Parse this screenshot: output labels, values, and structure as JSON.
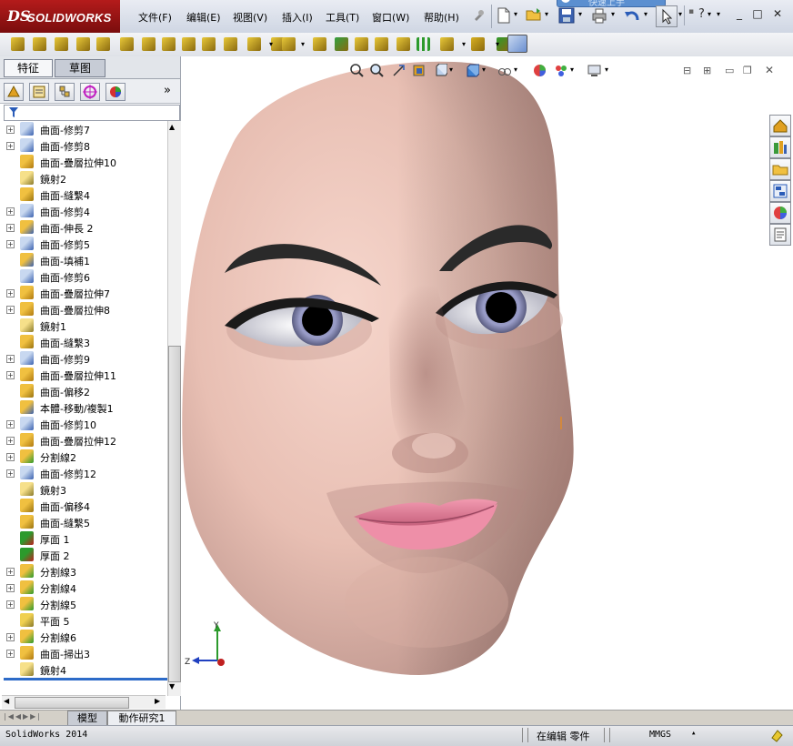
{
  "app": {
    "logo_ds": "DS",
    "logo_name": "SOLIDWORKS",
    "hint_text": "快速上手"
  },
  "menu": [
    {
      "label": "文件(F)"
    },
    {
      "label": "编辑(E)"
    },
    {
      "label": "视图(V)"
    },
    {
      "label": "插入(I)"
    },
    {
      "label": "工具(T)"
    },
    {
      "label": "窗口(W)"
    },
    {
      "label": "帮助(H)"
    }
  ],
  "panel_tabs": [
    {
      "label": "特征"
    },
    {
      "label": "草图"
    }
  ],
  "feature_tree": [
    {
      "label": "曲面-修剪7",
      "icon": "trim-icon",
      "expandable": true
    },
    {
      "label": "曲面-修剪8",
      "icon": "trim-icon",
      "expandable": true
    },
    {
      "label": "曲面-疊層拉伸10",
      "icon": "loft-icon",
      "expandable": false
    },
    {
      "label": "鏡射2",
      "icon": "mirror-icon",
      "expandable": false
    },
    {
      "label": "曲面-縫繫4",
      "icon": "knit-icon",
      "expandable": false
    },
    {
      "label": "曲面-修剪4",
      "icon": "trim-icon",
      "expandable": true
    },
    {
      "label": "曲面-伸長 2",
      "icon": "extend-icon",
      "expandable": true
    },
    {
      "label": "曲面-修剪5",
      "icon": "trim-icon",
      "expandable": true
    },
    {
      "label": "曲面-填補1",
      "icon": "fill-icon",
      "expandable": false
    },
    {
      "label": "曲面-修剪6",
      "icon": "trim-icon",
      "expandable": false
    },
    {
      "label": "曲面-疊層拉伸7",
      "icon": "loft-icon",
      "expandable": true
    },
    {
      "label": "曲面-疊層拉伸8",
      "icon": "loft-icon",
      "expandable": true
    },
    {
      "label": "鏡射1",
      "icon": "mirror-icon",
      "expandable": false
    },
    {
      "label": "曲面-縫繫3",
      "icon": "knit-icon",
      "expandable": false
    },
    {
      "label": "曲面-修剪9",
      "icon": "trim-icon",
      "expandable": true
    },
    {
      "label": "曲面-疊層拉伸11",
      "icon": "loft-icon",
      "expandable": true
    },
    {
      "label": "曲面-偏移2",
      "icon": "offset-icon",
      "expandable": false
    },
    {
      "label": "本體-移動/複製1",
      "icon": "move-copy-icon",
      "expandable": false
    },
    {
      "label": "曲面-修剪10",
      "icon": "trim-icon",
      "expandable": true
    },
    {
      "label": "曲面-疊層拉伸12",
      "icon": "loft-icon",
      "expandable": true
    },
    {
      "label": "分割線2",
      "icon": "split-line-icon",
      "expandable": true
    },
    {
      "label": "曲面-修剪12",
      "icon": "trim-icon",
      "expandable": true
    },
    {
      "label": "鏡射3",
      "icon": "mirror-icon",
      "expandable": false
    },
    {
      "label": "曲面-偏移4",
      "icon": "offset-icon",
      "expandable": false
    },
    {
      "label": "曲面-縫繫5",
      "icon": "knit-icon",
      "expandable": false
    },
    {
      "label": "厚面 1",
      "icon": "thicken-icon",
      "expandable": false
    },
    {
      "label": "厚面 2",
      "icon": "thicken-icon",
      "expandable": false
    },
    {
      "label": "分割線3",
      "icon": "split-line-icon",
      "expandable": true
    },
    {
      "label": "分割線4",
      "icon": "split-line-icon",
      "expandable": true
    },
    {
      "label": "分割線5",
      "icon": "split-line-icon",
      "expandable": true
    },
    {
      "label": "平面 5",
      "icon": "plane-icon",
      "expandable": false
    },
    {
      "label": "分割線6",
      "icon": "split-line-icon",
      "expandable": true
    },
    {
      "label": "曲面-掃出3",
      "icon": "sweep-icon",
      "expandable": true
    },
    {
      "label": "鏡射4",
      "icon": "mirror-icon",
      "expandable": false
    }
  ],
  "bottom_tabs": [
    {
      "label": "模型"
    },
    {
      "label": "動作研究1"
    }
  ],
  "status": {
    "app_version": "SolidWorks 2014",
    "mode": "在编辑 零件",
    "units": "MMGS"
  },
  "triad": {
    "y_label": "Y",
    "z_label": "Z"
  },
  "colors": {
    "skin": "#e8bfb3",
    "lips": "#e98aa3",
    "iris": "#8a8db8",
    "brand_red": "#a01616"
  }
}
